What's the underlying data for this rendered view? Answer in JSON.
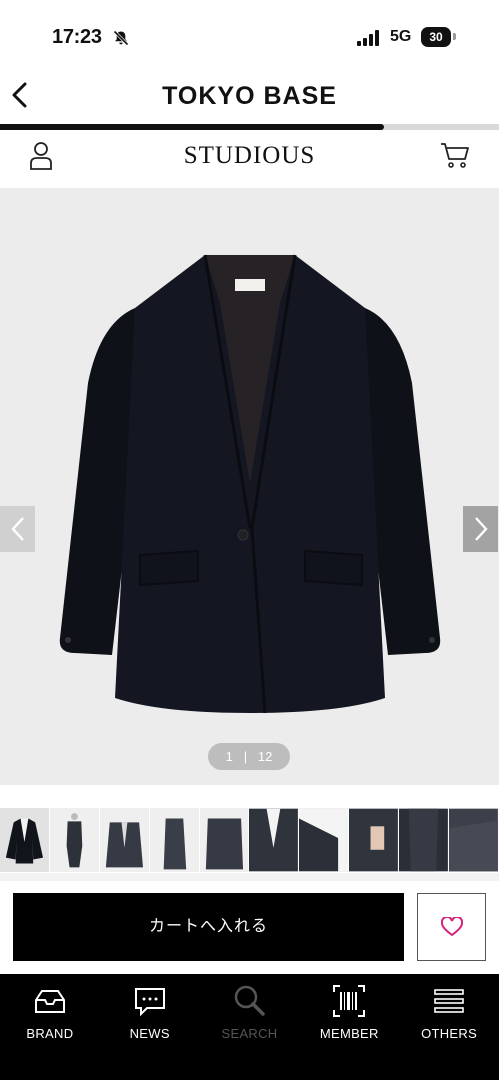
{
  "status_bar": {
    "time": "17:23",
    "network": "5G",
    "battery": "30"
  },
  "header": {
    "title": "TOKYO BASE",
    "progress_fraction": 0.77
  },
  "brand": {
    "name": "STUDIOUS"
  },
  "gallery": {
    "current": "1",
    "separator": "|",
    "total": "12",
    "thumbnail_count": 10
  },
  "actions": {
    "add_to_cart_label": "カートへ入れる",
    "favorite_color": "#d6247a"
  },
  "tabs": [
    {
      "label": "BRAND",
      "icon": "inbox-tray-icon"
    },
    {
      "label": "NEWS",
      "icon": "chat-bubble-icon"
    },
    {
      "label": "SEARCH",
      "icon": "magnifier-icon"
    },
    {
      "label": "MEMBER",
      "icon": "barcode-icon"
    },
    {
      "label": "OTHERS",
      "icon": "menu-lines-icon"
    }
  ]
}
